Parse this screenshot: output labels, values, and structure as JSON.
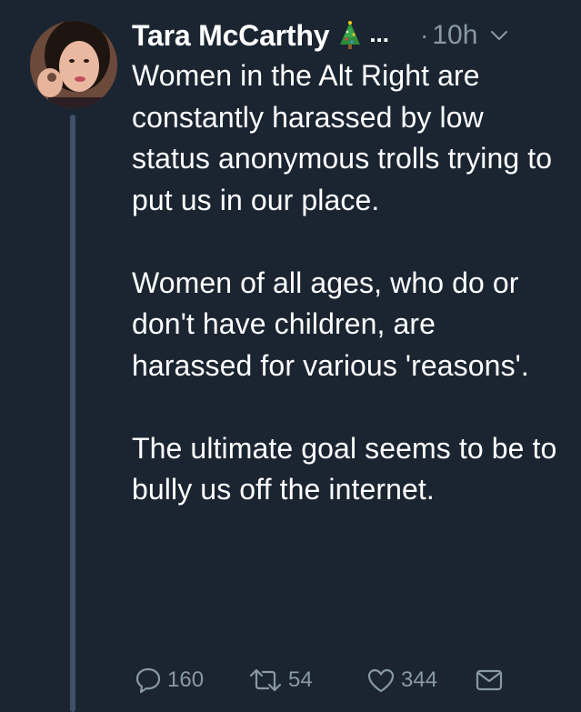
{
  "tweet": {
    "author_name": "Tara McCarthy",
    "name_emoji_icon": "christmas-tree-icon",
    "name_overflow": "...",
    "time_separator": "·",
    "timestamp": "10h",
    "paragraphs": [
      "Women in the Alt Right are constantly harassed by low status anonymous trolls trying to put us in our place.",
      "Women of all ages, who do or don't have children, are harassed for various 'reasons'.",
      "The ultimate goal seems to be to bully us off the internet."
    ],
    "actions": {
      "reply_count": "160",
      "retweet_count": "54",
      "like_count": "344"
    }
  },
  "colors": {
    "background": "#1b2532",
    "text": "#ffffff",
    "muted": "#8899a6",
    "thread_line": "#3e5168"
  }
}
